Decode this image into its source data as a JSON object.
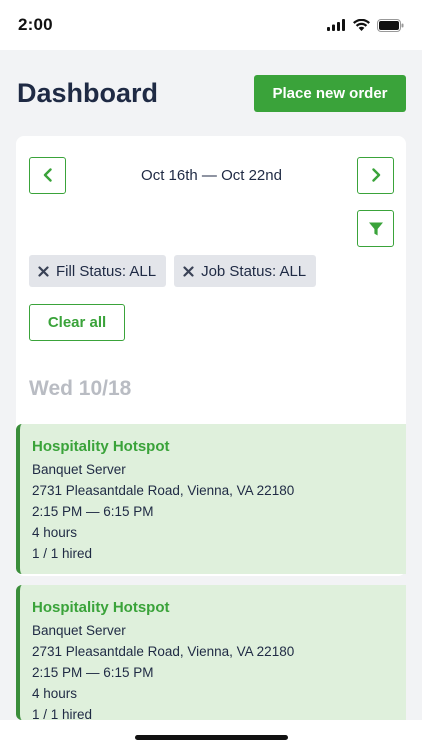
{
  "status_bar": {
    "time": "2:00"
  },
  "header": {
    "title": "Dashboard",
    "primary_action": "Place new order"
  },
  "week_nav": {
    "range": "Oct 16th — Oct 22nd"
  },
  "filters": {
    "chips": [
      "Fill Status: ALL",
      "Job Status: ALL"
    ],
    "clear_label": "Clear all"
  },
  "day": {
    "heading": "Wed 10/18"
  },
  "shifts": [
    {
      "company": "Hospitality Hotspot",
      "role": "Banquet Server",
      "address": "2731 Pleasantdale Road, Vienna, VA 22180",
      "time": "2:15 PM — 6:15 PM",
      "duration": "4 hours",
      "hired": "1 / 1 hired"
    },
    {
      "company": "Hospitality Hotspot",
      "role": "Banquet Server",
      "address": "2731 Pleasantdale Road, Vienna, VA 22180",
      "time": "2:15 PM — 6:15 PM",
      "duration": "4 hours",
      "hired": "1 / 1 hired"
    }
  ],
  "colors": {
    "accent": "#3aa33a",
    "card_bg": "#dff0dc",
    "title": "#1f2a44"
  },
  "icons": [
    "signal-icon",
    "wifi-icon",
    "battery-icon",
    "chevron-left-icon",
    "chevron-right-icon",
    "filter-icon",
    "close-icon"
  ]
}
